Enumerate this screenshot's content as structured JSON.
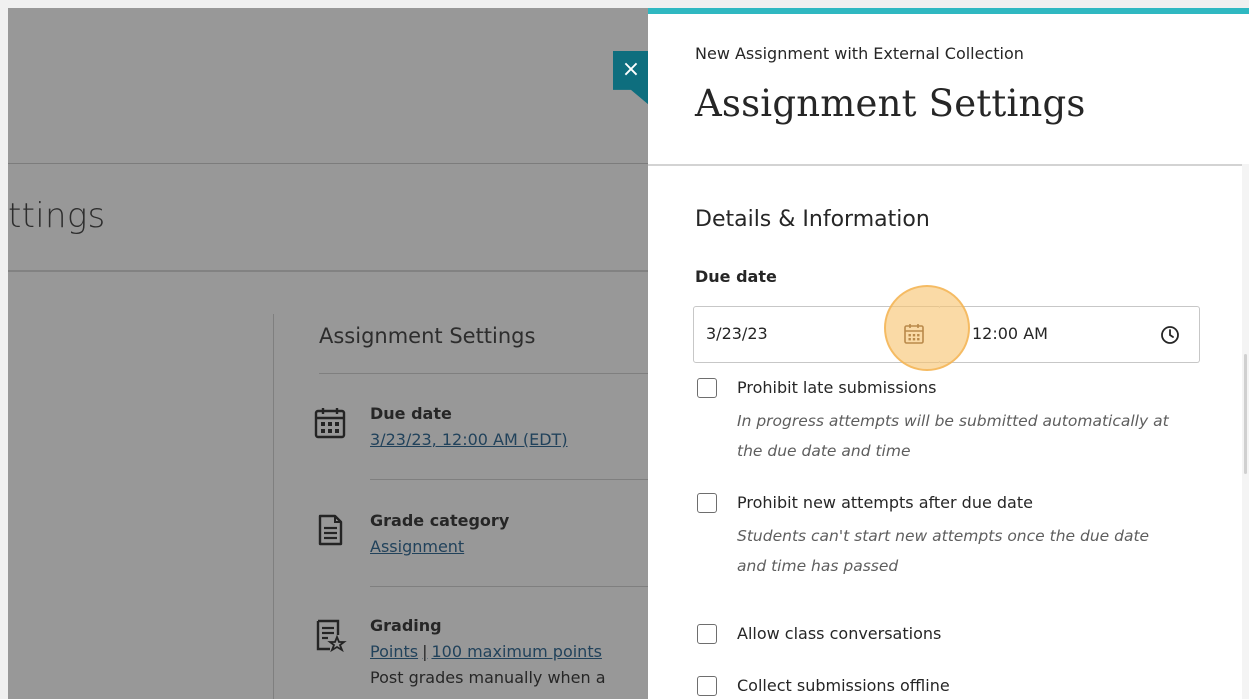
{
  "background": {
    "page_title_fragment": "ttings",
    "section_title": "Assignment Settings",
    "items": [
      {
        "label": "Due date",
        "value": "3/23/23, 12:00 AM (EDT)",
        "icon": "calendar-icon"
      },
      {
        "label": "Grade category",
        "value": "Assignment",
        "icon": "document-icon"
      },
      {
        "label": "Grading",
        "value_parts": [
          "Points",
          "|",
          "100 maximum points"
        ],
        "sub": "Post grades manually when a",
        "icon": "grading-icon"
      }
    ]
  },
  "panel": {
    "subtitle": "New Assignment with External Collection",
    "title": "Assignment Settings",
    "close_label": "×",
    "section_title": "Details & Information",
    "due_date": {
      "label": "Due date",
      "date_value": "3/23/23",
      "time_value": "12:00 AM"
    },
    "options": [
      {
        "label": "Prohibit late submissions",
        "help": "In progress attempts will be submitted automatically at the due date and time",
        "checked": false
      },
      {
        "label": "Prohibit new attempts after due date",
        "help": "Students can't start new attempts once the due date and time has passed",
        "checked": false
      },
      {
        "label": "Allow class conversations",
        "help": "",
        "checked": false
      },
      {
        "label": "Collect submissions offline",
        "help": "",
        "checked": false
      }
    ]
  },
  "colors": {
    "accent": "#2fb8c1",
    "close_tab": "#0e6e7e",
    "link": "#1c5a8a",
    "highlight": "#f7c370"
  }
}
